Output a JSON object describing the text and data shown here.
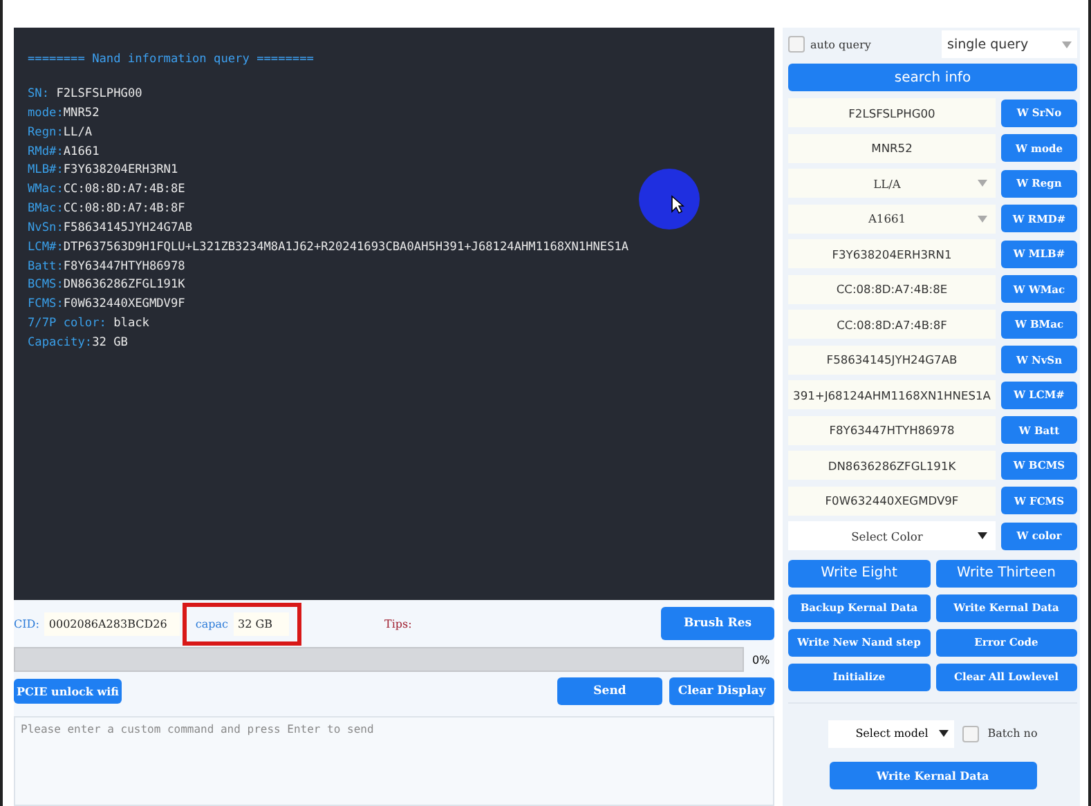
{
  "log": {
    "header": "========  Nand information query ========",
    "lines": [
      {
        "key": "SN: ",
        "value": "F2LSFSLPHG00"
      },
      {
        "key": "mode:",
        "value": "MNR52"
      },
      {
        "key": "Regn:",
        "value": "LL/A"
      },
      {
        "key": "RMd#:",
        "value": "A1661"
      },
      {
        "key": "MLB#:",
        "value": "F3Y638204ERH3RN1"
      },
      {
        "key": "WMac:",
        "value": "CC:08:8D:A7:4B:8E"
      },
      {
        "key": "BMac:",
        "value": "CC:08:8D:A7:4B:8F"
      },
      {
        "key": "NvSn:",
        "value": "F58634145JYH24G7AB"
      },
      {
        "key": "LCM#:",
        "value": "DTP637563D9H1FQLU+L321ZB3234M8A1J62+R20241693CBA0AH5H391+J68124AHM1168XN1HNES1A"
      },
      {
        "key": "Batt:",
        "value": "F8Y63447HTYH86978"
      },
      {
        "key": "BCMS:",
        "value": "DN8636286ZFGL191K"
      },
      {
        "key": "FCMS:",
        "value": "F0W632440XEGMDV9F"
      },
      {
        "key": "7/7P color: ",
        "value": "black"
      },
      {
        "key": "Capacity:",
        "value": "32 GB"
      }
    ]
  },
  "info_bar": {
    "ecid_label": "CID:",
    "ecid_value": "0002086A283BCD26",
    "capac_label": "capac",
    "capac_value": "32 GB",
    "capac_highlighted": true,
    "tips_label": "Tips:",
    "brush_button": "Brush Res"
  },
  "progress": {
    "level": 0,
    "reading": "0%"
  },
  "actions": {
    "unlock_button": "PCIE unlock wifi",
    "send_button": "Send",
    "clear_button": "Clear Display"
  },
  "command": {
    "placeholder": "Please enter a custom command and press Enter to send"
  },
  "query": {
    "auto_query_label": "auto query",
    "auto_query_checked": false,
    "mode": "single query",
    "search_button": "search info"
  },
  "fields": [
    {
      "kind": "field",
      "value": "F2LSFSLPHG00",
      "button": "W SrNo"
    },
    {
      "kind": "field",
      "value": "MNR52",
      "button": "W mode"
    },
    {
      "kind": "select",
      "value": "LL/A",
      "button": "W Regn"
    },
    {
      "kind": "select",
      "value": "A1661",
      "button": "W RMD#"
    },
    {
      "kind": "field",
      "value": "F3Y638204ERH3RN1",
      "button": "W MLB#"
    },
    {
      "kind": "field",
      "value": "CC:08:8D:A7:4B:8E",
      "button": "W WMac"
    },
    {
      "kind": "field",
      "value": "CC:08:8D:A7:4B:8F",
      "button": "W BMac"
    },
    {
      "kind": "field",
      "value": "F58634145JYH24G7AB",
      "button": "W NvSn"
    },
    {
      "kind": "field",
      "value": "391+J68124AHM1168XN1HNES1A",
      "button": "W LCM#"
    },
    {
      "kind": "field",
      "value": "F8Y63447HTYH86978",
      "button": "W Batt"
    },
    {
      "kind": "field",
      "value": "DN8636286ZFGL191K",
      "button": "W BCMS"
    },
    {
      "kind": "field",
      "value": "F0W632440XEGMDV9F",
      "button": "W FCMS"
    },
    {
      "kind": "dropdown",
      "value": "Select Color",
      "button": "W color"
    }
  ],
  "operations": [
    "Write Eight",
    "Write Thirteen",
    "Backup Kernal Data",
    "Write Kernal Data",
    "Write New Nand step",
    "Error Code",
    "Initialize",
    "Clear All Lowlevel"
  ],
  "batch": {
    "model": "Select model",
    "batch_label": "Batch no",
    "batch_checked": false,
    "write_button": "Write Kernal Data"
  }
}
